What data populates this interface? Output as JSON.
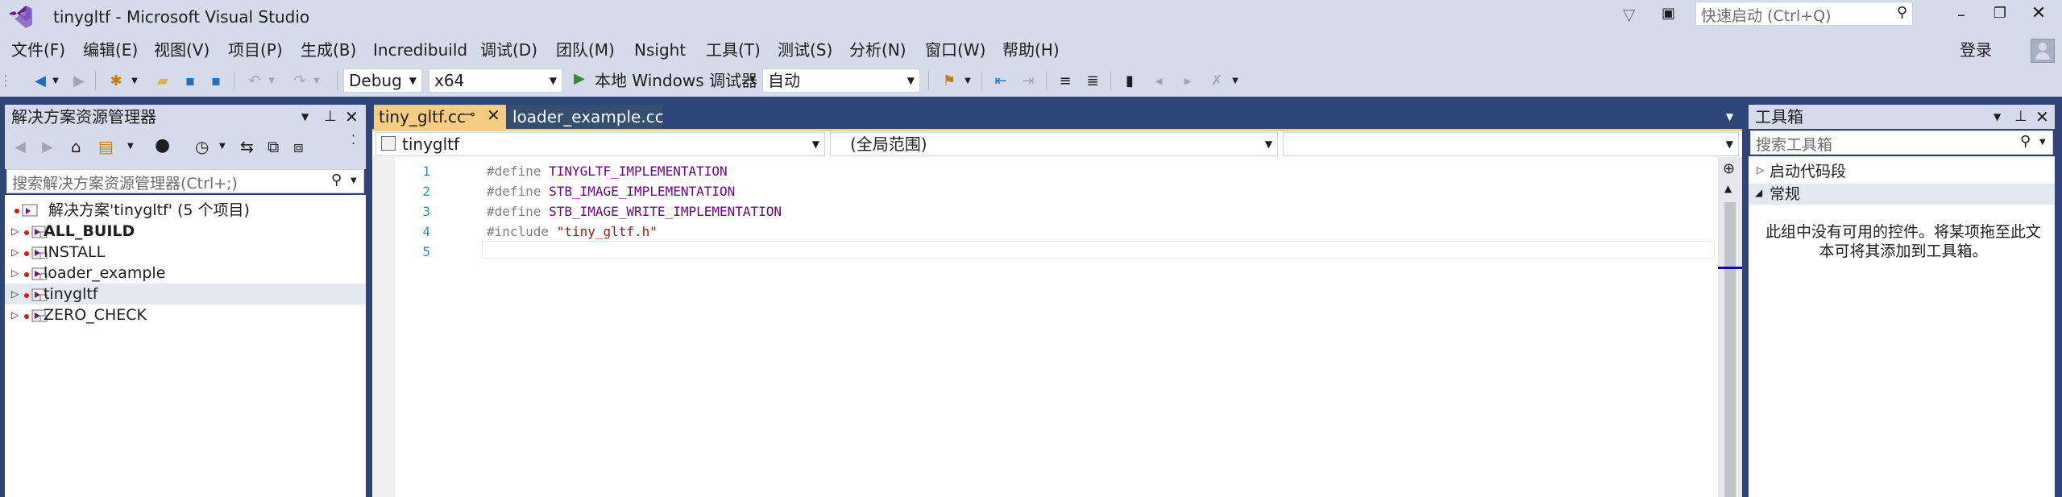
{
  "window": {
    "title": "tinygltf - Microsoft Visual Studio",
    "quick_launch_placeholder": "快速启动 (Ctrl+Q)",
    "login_label": "登录"
  },
  "menu": [
    "文件(F)",
    "编辑(E)",
    "视图(V)",
    "项目(P)",
    "生成(B)",
    "Incredibuild",
    "调试(D)",
    "团队(M)",
    "Nsight",
    "工具(T)",
    "测试(S)",
    "分析(N)",
    "窗口(W)",
    "帮助(H)"
  ],
  "toolbar": {
    "config": "Debug",
    "platform": "x64",
    "run_label": "本地 Windows 调试器",
    "mode": "自动"
  },
  "solution_explorer": {
    "title": "解决方案资源管理器",
    "search_placeholder": "搜索解决方案资源管理器(Ctrl+;)",
    "solution_label": "解决方案'tinygltf' (5 个项目)",
    "projects": [
      {
        "name": "ALL_BUILD",
        "bold": true,
        "selected": false
      },
      {
        "name": "INSTALL",
        "bold": false,
        "selected": false
      },
      {
        "name": "loader_example",
        "bold": false,
        "selected": false
      },
      {
        "name": "tinygltf",
        "bold": false,
        "selected": true
      },
      {
        "name": "ZERO_CHECK",
        "bold": false,
        "selected": false
      }
    ]
  },
  "editor": {
    "tabs": [
      {
        "label": "tiny_gltf.cc",
        "active": true
      },
      {
        "label": "loader_example.cc",
        "active": false
      }
    ],
    "nav_project": "tinygltf",
    "nav_scope": "(全局范围)",
    "nav_member": "",
    "lines": [
      {
        "num": "1",
        "kw": "#define",
        "rest": " TINYGLTF_IMPLEMENTATION",
        "str": ""
      },
      {
        "num": "2",
        "kw": "#define",
        "rest": " STB_IMAGE_IMPLEMENTATION",
        "str": ""
      },
      {
        "num": "3",
        "kw": "#define",
        "rest": " STB_IMAGE_WRITE_IMPLEMENTATION",
        "str": ""
      },
      {
        "num": "4",
        "kw": "#include",
        "rest": " ",
        "str": "\"tiny_gltf.h\""
      },
      {
        "num": "5",
        "kw": "",
        "rest": "",
        "str": ""
      }
    ]
  },
  "toolbox": {
    "title": "工具箱",
    "search_placeholder": "搜索工具箱",
    "groups": [
      "启动代码段",
      "常规"
    ],
    "empty_message": "此组中没有可用的控件。将某项拖至此文本可将其添加到工具箱。"
  },
  "colors": {
    "chrome": "#d6dbe9",
    "frame": "#2f4577",
    "active_tab": "#f5cc84",
    "inactive_tab": "#364e6f",
    "keyword_gray": "#808080",
    "macro_purple": "#6f008a",
    "string_red": "#a31515",
    "line_number": "#2b91af",
    "selection": "#e4e8f1"
  }
}
